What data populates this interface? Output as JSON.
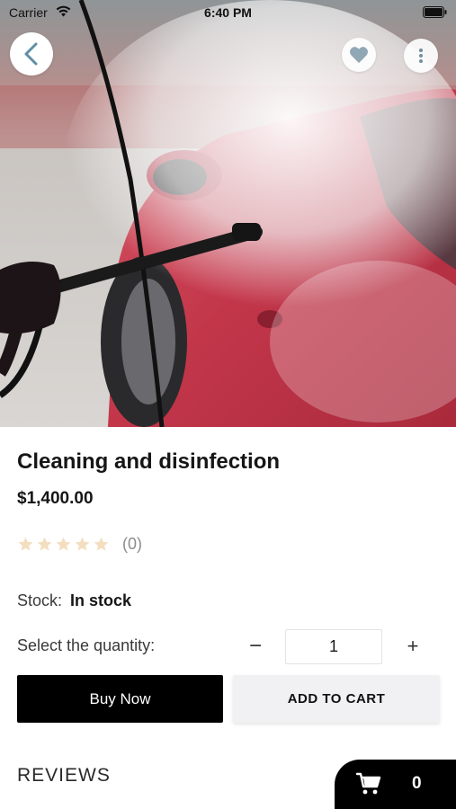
{
  "status_bar": {
    "carrier": "Carrier",
    "time": "6:40 PM"
  },
  "product": {
    "title": "Cleaning and disinfection",
    "price": "$1,400.00",
    "rating_stars": 0,
    "rating_max": 5,
    "rating_count": "(0)",
    "stock_label": "Stock:",
    "stock_value": "In stock"
  },
  "quantity": {
    "label": "Select the quantity:",
    "value": "1",
    "minus_symbol": "−",
    "plus_symbol": "+"
  },
  "actions": {
    "buy_now": "Buy Now",
    "add_to_cart": "ADD TO CART"
  },
  "reviews": {
    "heading": "REVIEWS"
  },
  "cart": {
    "count": "0"
  },
  "icons": {
    "back": "chevron-left-icon",
    "favorite": "heart-icon",
    "more": "more-vertical-icon",
    "cart": "cart-icon",
    "star": "star-icon"
  },
  "colors": {
    "primary_button": "#000000",
    "secondary_button": "#f1f1f3",
    "star_empty": "#f3dfbf",
    "heart": "#8aa3b2",
    "back_chevron": "#5e8ea6",
    "car_red": "#c8384a"
  }
}
